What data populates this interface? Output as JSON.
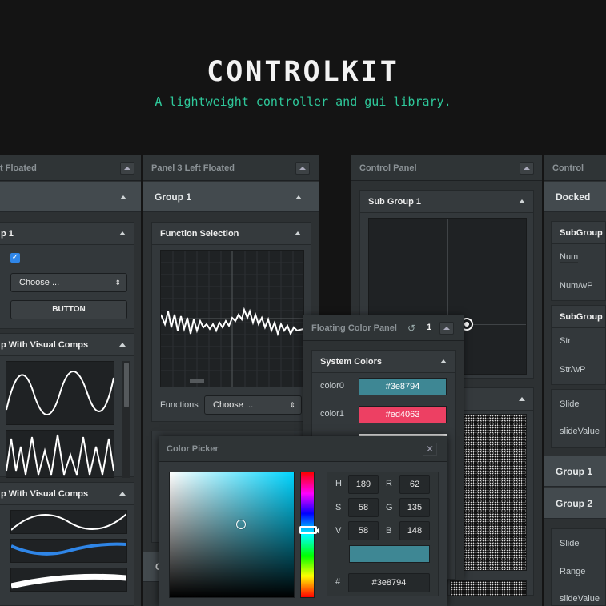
{
  "hero": {
    "title": "CONTROLKIT",
    "subtitle": "A lightweight controller and gui library."
  },
  "panel_left": {
    "title": "t Floated",
    "group": "",
    "sub1": "p 1",
    "choose": "Choose ...",
    "button": "BUTTON",
    "sub2": "p With Visual Comps",
    "sub3": "p With Visual Comps"
  },
  "panel3": {
    "title": "Panel 3 Left Floated",
    "group": "Group 1",
    "sub": "Function Selection",
    "functions_label": "Functions",
    "functions_value": "Choose ...",
    "group_bottom": "G"
  },
  "control_panel": {
    "title": "Control Panel",
    "sub": "Sub Group 1"
  },
  "control_panel_right": {
    "title": "Control Pane",
    "group": "Docked Pan",
    "sub1": "SubGroup",
    "num": "Num",
    "numwp": "Num/wP",
    "sub2": "SubGroup",
    "str": "Str",
    "strwp": "Str/wP",
    "slide": "Slide",
    "slidevalue": "slideValue",
    "group1": "Group 1",
    "group2": "Group 2",
    "slide2": "Slide",
    "range": "Range",
    "slidevalue2": "slideValue"
  },
  "floating": {
    "title": "Floating Color Panel",
    "count": "1",
    "sub": "System Colors",
    "color0_label": "color0",
    "color0_value": "#3e8794",
    "color1_label": "color1",
    "color1_value": "#ed4063"
  },
  "picker": {
    "title": "Color Picker",
    "h_label": "H",
    "h": "189",
    "r_label": "R",
    "r": "62",
    "s_label": "S",
    "s": "58",
    "g_label": "G",
    "g": "135",
    "v_label": "V",
    "v": "58",
    "b_label": "B",
    "b": "148",
    "hash_label": "#",
    "hex": "#3e8794"
  },
  "colors": {
    "accent": "#2ec89a",
    "color0": "#3e8794",
    "color1": "#ed4063"
  }
}
